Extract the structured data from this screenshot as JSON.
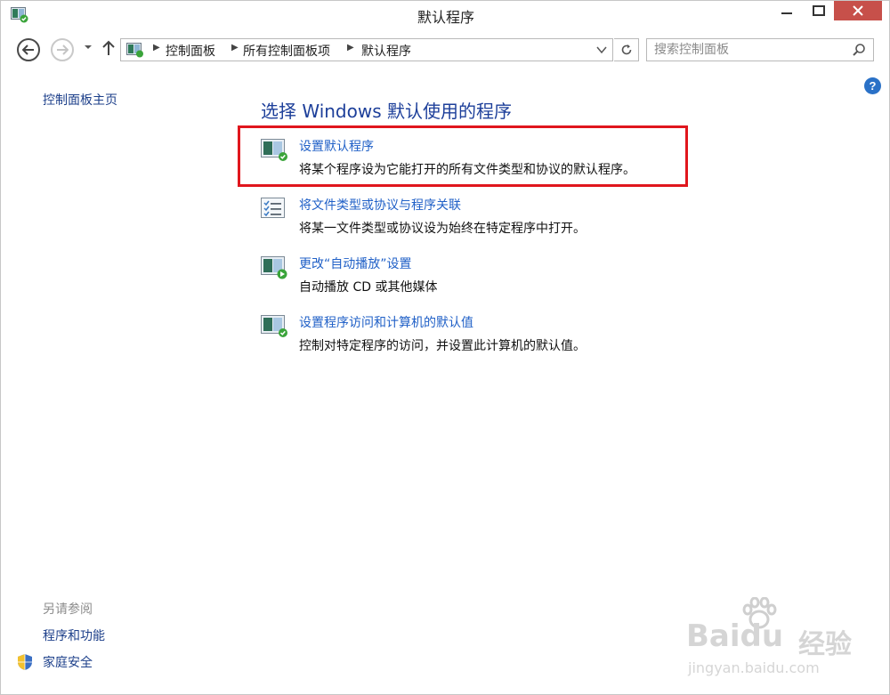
{
  "window": {
    "title": "默认程序"
  },
  "titlebar": {
    "app_icon": "control-panel-icon",
    "minimize_icon": "minimize-icon",
    "maximize_icon": "maximize-icon",
    "close_icon": "close-icon",
    "close_color": "#c7504a"
  },
  "nav": {
    "breadcrumbs": [
      "控制面板",
      "所有控制面板项",
      "默认程序"
    ],
    "search_placeholder": "搜索控制面板"
  },
  "sidebar": {
    "home_link": "控制面板主页",
    "see_also_heading": "另请参阅",
    "see_also_links": [
      "程序和功能",
      "家庭安全"
    ]
  },
  "main": {
    "title": "选择 Windows 默认使用的程序",
    "tasks": [
      {
        "link": "设置默认程序",
        "description": "将某个程序设为它能打开的所有文件类型和协议的默认程序。",
        "icon": "default-programs-icon"
      },
      {
        "link": "将文件类型或协议与程序关联",
        "description": "将某一文件类型或协议设为始终在特定程序中打开。",
        "icon": "file-association-icon"
      },
      {
        "link": "更改“自动播放”设置",
        "description": "自动播放 CD 或其他媒体",
        "icon": "autoplay-icon"
      },
      {
        "link": "设置程序访问和计算机的默认值",
        "description": "控制对特定程序的访问，并设置此计算机的默认值。",
        "icon": "program-access-icon"
      }
    ]
  },
  "colors": {
    "link": "#2060c7",
    "title": "#1d3f9a",
    "highlight": "#e0161d",
    "help": "#2a71c7"
  },
  "watermark": {
    "brand": "Baidu",
    "brand_cn": "经验",
    "url": "jingyan.baidu.com"
  }
}
